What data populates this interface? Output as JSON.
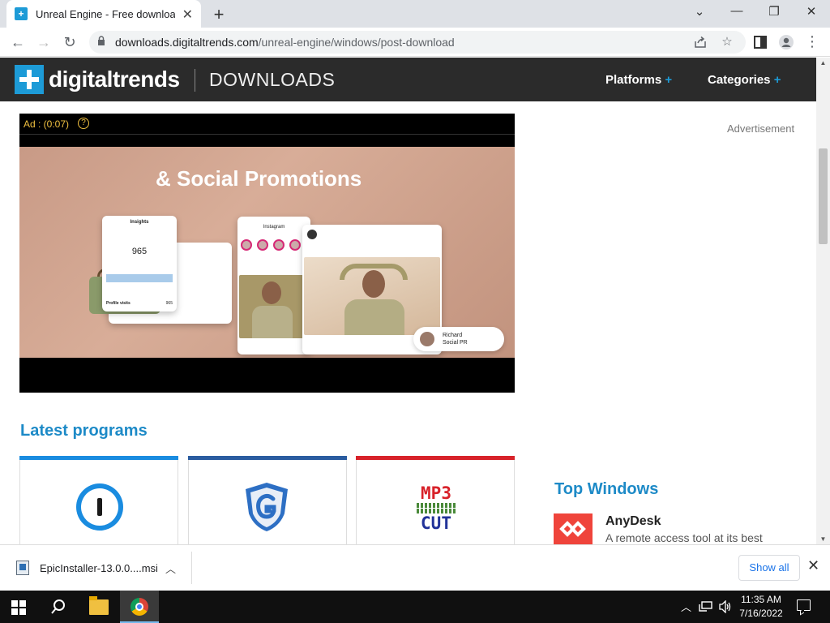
{
  "browser": {
    "tab_title": "Unreal Engine - Free download",
    "tab_close": "✕",
    "new_tab": "+",
    "minimize": "⌄",
    "restore": "—",
    "maximize": "❐",
    "close": "✕",
    "url_domain": "downloads.digitaltrends.com",
    "url_path": "/unreal-engine/windows/post-download",
    "back": "←",
    "forward": "→",
    "reload": "↻",
    "share_icon": "share-icon",
    "star_icon": "star-icon",
    "sidepanel_icon": "side-panel-icon",
    "profile_icon": "profile-icon",
    "menu_icon": "⋮"
  },
  "site": {
    "logo_text": "digitaltrends",
    "section": "DOWNLOADS",
    "nav": [
      {
        "label": "Platforms",
        "plus": "+"
      },
      {
        "label": "Categories",
        "plus": "+"
      }
    ],
    "accent": "#1d9bd7"
  },
  "ad": {
    "label": "Ad : (0:07)",
    "help": "?",
    "headline": "& Social Promotions",
    "insights_title": "Insights",
    "insights_value": "965",
    "insights_footer": "Profile visits",
    "insights_footer_value": "965",
    "phone_title": "Instagram",
    "pill_name": "Richard",
    "pill_label": "Social PR",
    "advertisement_label": "Advertisement"
  },
  "latest": {
    "title": "Latest programs",
    "cards": [
      {
        "name": "1password-logo",
        "bar_color": "#1a8ce0"
      },
      {
        "name": "glary-shield-logo",
        "bar_color": "#2a5ca0"
      },
      {
        "name": "mp3-cut-logo",
        "bar_color": "#d8222a",
        "top_text": "MP3",
        "bottom_text": "CUT"
      }
    ]
  },
  "top_windows": {
    "title": "Top Windows",
    "items": [
      {
        "name": "AnyDesk",
        "desc": "A remote access tool at its best"
      }
    ]
  },
  "download_bar": {
    "file": "EpicInstaller-13.0.0....msi",
    "chevron": "︿",
    "show_all": "Show all",
    "close": "✕"
  },
  "taskbar": {
    "time": "11:35 AM",
    "date": "7/16/2022",
    "tray_chevron": "︿",
    "tray_network": "🖧",
    "tray_volume": "🔊"
  }
}
